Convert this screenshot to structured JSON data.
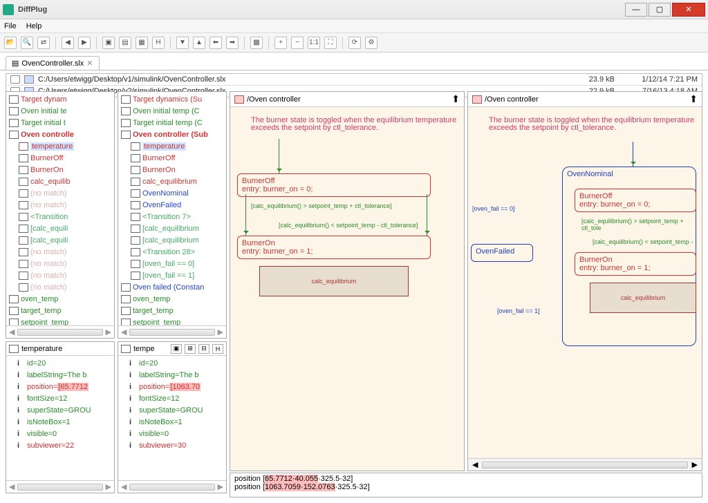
{
  "title": "DiffPlug",
  "menu": {
    "file": "File",
    "help": "Help"
  },
  "tab": {
    "name": "OvenController.slx",
    "close": "✕"
  },
  "files": {
    "left": {
      "path": "C:/Users/etwigg/Desktop/v1/simulink/OvenController.slx",
      "size": "23.9 kB",
      "date": "1/12/14 7:21 PM"
    },
    "right": {
      "path": "C:/Users/etwigg/Desktop/v2/simulink/OvenController.slx",
      "size": "22.9 kB",
      "date": "7/16/13 4:18 AM"
    }
  },
  "treeL": [
    {
      "t": "Target dynam",
      "c": "red",
      "i": 0
    },
    {
      "t": "Oven initial te",
      "c": "green",
      "i": 0
    },
    {
      "t": "Target initial t",
      "c": "green",
      "i": 0
    },
    {
      "t": "Oven controlle",
      "c": "red-bold",
      "i": 0
    },
    {
      "t": "temperature",
      "c": "red",
      "i": 1,
      "sel": true
    },
    {
      "t": "BurnerOff",
      "c": "red",
      "i": 1
    },
    {
      "t": "BurnerOn",
      "c": "red",
      "i": 1
    },
    {
      "t": "calc_equilib",
      "c": "red",
      "i": 1
    },
    {
      "t": "(no match)",
      "c": "faded",
      "i": 1
    },
    {
      "t": "(no match)",
      "c": "faded",
      "i": 1
    },
    {
      "t": "<Transition",
      "c": "link",
      "i": 1
    },
    {
      "t": "[calc_equili",
      "c": "link",
      "i": 1
    },
    {
      "t": "[calc_equili",
      "c": "link",
      "i": 1
    },
    {
      "t": "(no match)",
      "c": "faded",
      "i": 1
    },
    {
      "t": "(no match)",
      "c": "faded",
      "i": 1
    },
    {
      "t": "(no match)",
      "c": "faded",
      "i": 1
    },
    {
      "t": "(no match)",
      "c": "faded",
      "i": 1
    },
    {
      "t": "oven_temp",
      "c": "green",
      "i": 0
    },
    {
      "t": "target_temp",
      "c": "green",
      "i": 0
    },
    {
      "t": "setpoint_temp",
      "c": "green",
      "i": 0
    }
  ],
  "treeR": [
    {
      "t": "Target dynamics (Su",
      "c": "red",
      "i": 0
    },
    {
      "t": "Oven initial temp (C",
      "c": "green",
      "i": 0
    },
    {
      "t": "Target initial temp (C",
      "c": "green",
      "i": 0
    },
    {
      "t": "Oven controller (Sub",
      "c": "red-bold",
      "i": 0
    },
    {
      "t": "temperature",
      "c": "red",
      "i": 1,
      "sel": true
    },
    {
      "t": "BurnerOff",
      "c": "red",
      "i": 1
    },
    {
      "t": "BurnerOn",
      "c": "red",
      "i": 1
    },
    {
      "t": "calc_equilibrium",
      "c": "red",
      "i": 1
    },
    {
      "t": "OvenNominal",
      "c": "blue",
      "i": 1
    },
    {
      "t": "OvenFailed",
      "c": "blue",
      "i": 1
    },
    {
      "t": "<Transition 7>",
      "c": "link",
      "i": 1
    },
    {
      "t": "[calc_equilibrium",
      "c": "link",
      "i": 1
    },
    {
      "t": "[calc_equilibrium",
      "c": "link",
      "i": 1
    },
    {
      "t": "<Transition 28>",
      "c": "link",
      "i": 1
    },
    {
      "t": "[oven_fail == 0]",
      "c": "link",
      "i": 1
    },
    {
      "t": "[oven_fail == 1]",
      "c": "link",
      "i": 1
    },
    {
      "t": "Oven failed (Constan",
      "c": "blue",
      "i": 0
    },
    {
      "t": "oven_temp",
      "c": "green",
      "i": 0
    },
    {
      "t": "target_temp",
      "c": "green",
      "i": 0
    },
    {
      "t": "setpoint_temp",
      "c": "green",
      "i": 0
    }
  ],
  "props": {
    "leftTitle": "temperature",
    "rightTitle": "tempe",
    "rows": [
      {
        "k": "id=20",
        "c": "green"
      },
      {
        "k": "labelString=The b",
        "c": "green"
      },
      {
        "kL": "position=[65.7712",
        "kR": "position=[1063.70",
        "c": "red",
        "hl": true
      },
      {
        "k": "fontSize=12",
        "c": "green"
      },
      {
        "k": "superState=GROU",
        "c": "green"
      },
      {
        "k": "isNoteBox=1",
        "c": "green"
      },
      {
        "k": "visible=0",
        "c": "green"
      },
      {
        "kL": "subviewer=22",
        "kR": "subviewer=30",
        "c": "red"
      }
    ]
  },
  "diag": {
    "title": "/Oven controller",
    "note1": "The burner state is toggled when the equilibrium temperature",
    "note2": "exceeds the setpoint by ctl_tolerance.",
    "burnerOff": "BurnerOff",
    "burnerOffEntry": "entry: burner_on = 0;",
    "burnerOn": "BurnerOn",
    "burnerOnEntry": "entry: burner_on = 1;",
    "cond1": "[calc_equilibrium() > setpoint_temp + ctl_tolerance]",
    "cond2": "[calc_equilibrium() < setpoint_temp - ctl_tolerance]",
    "calc": "calc_equilibrium",
    "ovenNominal": "OvenNominal",
    "ovenFailed": "OvenFailed",
    "ovenFailCond0": "[oven_fail == 0]",
    "ovenFailCond1": "[oven_fail == 1]",
    "cond1b": "[calc_equilibrium() > setpoint_temp + ctl_tole",
    "cond2b": "[calc_equilibrium() < setpoint_temp -"
  },
  "bottom": {
    "l1a": "position [",
    "l1b": "65.7712·40.055",
    "l1c": "·325.5·32]",
    "l2a": "position [",
    "l2b": "1063.7059·152.0763",
    "l2c": "·325.5·32]"
  }
}
